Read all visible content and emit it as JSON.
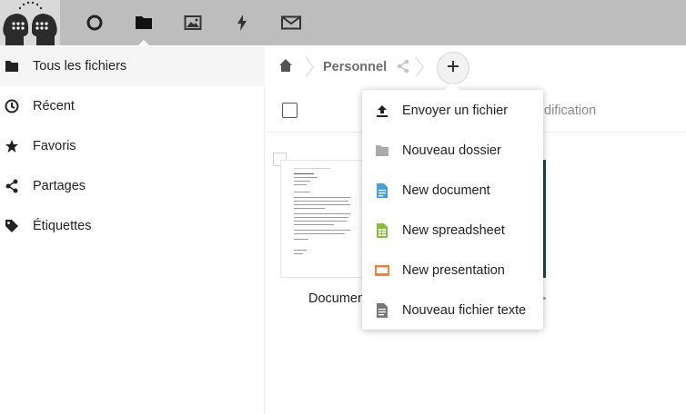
{
  "header": {
    "logo": "two-heads-logo",
    "apps": [
      {
        "name": "dashboard",
        "icon": "circle-icon"
      },
      {
        "name": "files",
        "icon": "folder-icon",
        "active": true
      },
      {
        "name": "photos",
        "icon": "image-icon"
      },
      {
        "name": "activity",
        "icon": "lightning-icon"
      },
      {
        "name": "mail",
        "icon": "mail-icon"
      }
    ]
  },
  "nav": {
    "items": [
      {
        "label": "Tous les fichiers",
        "icon": "folder-icon",
        "active": true
      },
      {
        "label": "Récent",
        "icon": "clock-icon"
      },
      {
        "label": "Favoris",
        "icon": "star-icon"
      },
      {
        "label": "Partages",
        "icon": "share-icon"
      },
      {
        "label": "Étiquettes",
        "icon": "tag-icon"
      }
    ]
  },
  "breadcrumb": {
    "home_icon": "home-icon",
    "current": "Personnel"
  },
  "list": {
    "modified_header": "dification"
  },
  "files": [
    {
      "name": "Documen"
    }
  ],
  "menu": {
    "items": [
      {
        "label": "Envoyer un fichier",
        "icon": "upload-icon",
        "color": "#222222"
      },
      {
        "label": "Nouveau dossier",
        "icon": "folder-icon",
        "color": "#aaaaaa"
      },
      {
        "label": "New document",
        "icon": "document-icon",
        "color": "#4a9fd8"
      },
      {
        "label": "New spreadsheet",
        "icon": "spreadsheet-icon",
        "color": "#8bbd3c"
      },
      {
        "label": "New presentation",
        "icon": "presentation-icon",
        "color": "#e8843c"
      },
      {
        "label": "Nouveau fichier texte",
        "icon": "text-file-icon",
        "color": "#777777"
      }
    ]
  },
  "colors": {
    "header_bg": "#bdbdbd",
    "nav_active_bg": "#f5f5f5"
  }
}
